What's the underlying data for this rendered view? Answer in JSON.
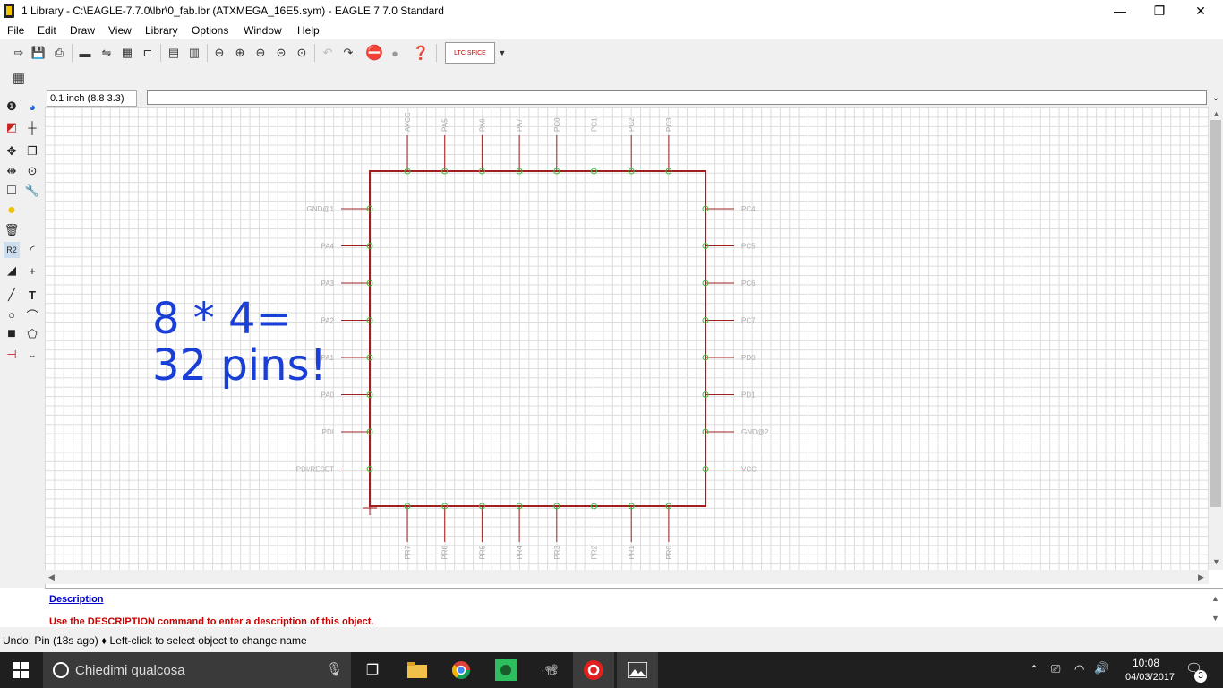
{
  "window": {
    "title": "1 Library - C:\\EAGLE-7.7.0\\lbr\\0_fab.lbr (ATXMEGA_16E5.sym) - EAGLE 7.7.0 Standard",
    "minimize": "—",
    "maximize": "❐",
    "close": "✕"
  },
  "menu": [
    "File",
    "Edit",
    "Draw",
    "View",
    "Library",
    "Options",
    "Window",
    "Help"
  ],
  "toolbar": {
    "ltspice_label": "LTC SPICE"
  },
  "command": {
    "coord": "0.1 inch (8.8 3.3)",
    "value": ""
  },
  "annotation": "8 * 4=\n32 pins!",
  "pins": {
    "top": [
      "AVCC",
      "PA5",
      "PA6",
      "PA7",
      "PC0",
      "PC1",
      "PC2",
      "PC3"
    ],
    "left": [
      "GND@1",
      "PA4",
      "PA3",
      "PA2",
      "PA1",
      "PA0",
      "PDI",
      "PDI/RESET"
    ],
    "right": [
      "PC4",
      "PC5",
      "PC6",
      "PC7",
      "PD0",
      "PD1",
      "GND@2",
      "VCC"
    ],
    "bottom": [
      "PR7",
      "PR6",
      "PR5",
      "PR4",
      "PR3",
      "PR2",
      "PR1",
      "PR0"
    ]
  },
  "description": {
    "title": "Description",
    "text": "Use the DESCRIPTION command to enter a description of this object."
  },
  "status": "Undo: Pin (18s ago)  ♦ Left-click to select object to change name",
  "taskbar": {
    "search_placeholder": "Chiedimi qualcosa",
    "time": "10:08",
    "date": "04/03/2017",
    "notifications": "3"
  },
  "colors": {
    "symbol_outline": "#a02020",
    "pin_label": "#aaaaaa",
    "pin_name_green": "#44bb44",
    "annotation": "#1a3fd6"
  }
}
